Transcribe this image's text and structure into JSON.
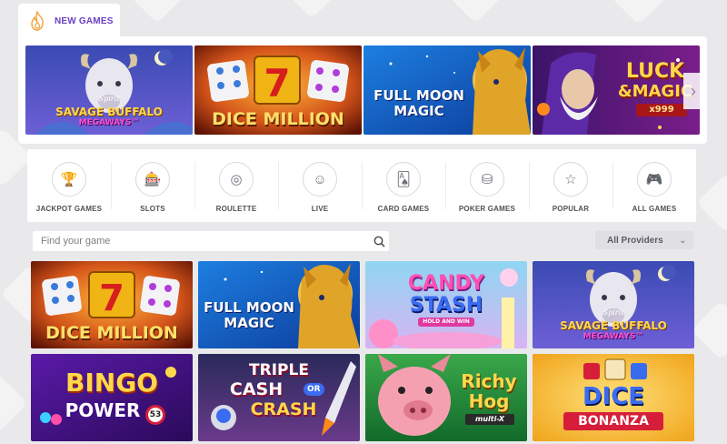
{
  "section": {
    "title": "NEW GAMES"
  },
  "new_games": [
    {
      "badge": "Spirit",
      "title": "SAVAGE BUFFALO",
      "subtitle": "MEGAWAYS™"
    },
    {
      "title": "DICE MILLION"
    },
    {
      "title_line1": "FULL MOON",
      "title_line2": "MAGIC"
    },
    {
      "title_line1": "LUCK",
      "title_line2": "&MAGIC",
      "subtitle": "x999"
    }
  ],
  "categories": [
    {
      "label": "JACKPOT GAMES",
      "icon": "trophy-icon",
      "glyph": "🏆"
    },
    {
      "label": "SLOTS",
      "icon": "slot-machine-icon",
      "glyph": "🎰"
    },
    {
      "label": "ROULETTE",
      "icon": "roulette-icon",
      "glyph": "◎"
    },
    {
      "label": "LIVE",
      "icon": "live-dealer-icon",
      "glyph": "☺"
    },
    {
      "label": "CARD GAMES",
      "icon": "cards-icon",
      "glyph": "🂡"
    },
    {
      "label": "POKER GAMES",
      "icon": "poker-chip-icon",
      "glyph": "⛁"
    },
    {
      "label": "POPULAR",
      "icon": "star-icon",
      "glyph": "☆"
    },
    {
      "label": "ALL GAMES",
      "icon": "gamepad-icon",
      "glyph": "🎮"
    }
  ],
  "search": {
    "placeholder": "Find your game"
  },
  "providers": {
    "selected": "All Providers"
  },
  "games": [
    {
      "title": "DICE MILLION"
    },
    {
      "title_line1": "FULL MOON",
      "title_line2": "MAGIC"
    },
    {
      "title_line1": "CANDY",
      "title_line2": "STASH",
      "subtitle": "HOLD AND WIN"
    },
    {
      "badge": "Spirit",
      "title": "SAVAGE BUFFALO",
      "subtitle": "MEGAWAYS™"
    },
    {
      "title_line1": "BINGO",
      "title_line2": "POWER",
      "ball": "53"
    },
    {
      "title_line1": "TRIPLE",
      "title_line2": "CASH",
      "title_line3": "CRASH",
      "connector": "OR"
    },
    {
      "title_line1": "Richy",
      "title_line2": "Hog",
      "subtitle": "multi-X"
    },
    {
      "title_line1": "DICE",
      "title_line2": "BONANZA"
    }
  ]
}
